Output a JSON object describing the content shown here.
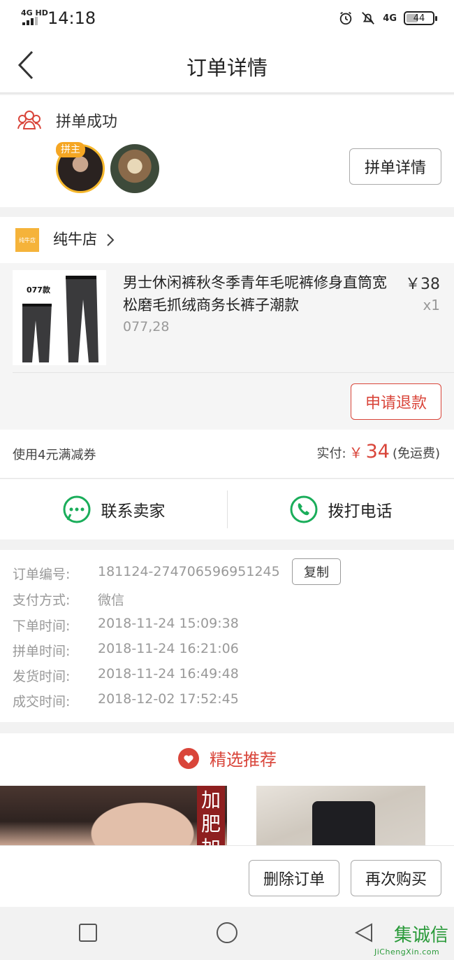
{
  "status_bar": {
    "network": "4G HD",
    "time": "14:18",
    "network_right": "4G",
    "battery": "44"
  },
  "header": {
    "title": "订单详情"
  },
  "group_buy": {
    "status": "拼单成功",
    "host_badge": "拼主",
    "detail_button": "拼单详情"
  },
  "shop": {
    "logo_text": "纯牛店",
    "name": "纯牛店"
  },
  "product": {
    "title": "男士休闲裤秋冬季青年毛呢裤修身直筒宽松磨毛抓绒商务长裤子潮款",
    "price": "￥38",
    "quantity": "x1",
    "sku": "077,28",
    "thumb_label": "077款",
    "refund_button": "申请退款"
  },
  "payment": {
    "coupon": "使用4元满减券",
    "paid_label": "实付:",
    "currency": "￥",
    "amount": "34",
    "shipping_note": "(免运费)"
  },
  "contact": {
    "seller": "联系卖家",
    "call": "拨打电话"
  },
  "order_info": [
    {
      "key": "订单编号:",
      "value": "181124-274706596951245"
    },
    {
      "key": "支付方式:",
      "value": "微信"
    },
    {
      "key": "下单时间:",
      "value": "2018-11-24 15:09:38"
    },
    {
      "key": "拼单时间:",
      "value": "2018-11-24 16:21:06"
    },
    {
      "key": "发货时间:",
      "value": "2018-11-24 16:49:48"
    },
    {
      "key": "成交时间:",
      "value": "2018-12-02 17:52:45"
    }
  ],
  "copy_button": "复制",
  "recommend": {
    "title": "精选推荐",
    "promo_tag": "加肥加"
  },
  "actions": {
    "delete": "删除订单",
    "rebuy": "再次购买"
  },
  "watermark": {
    "logo": "集诚信",
    "url": "JiChengXin.com"
  },
  "colors": {
    "accent": "#d9453a",
    "wechat_green": "#1aad5a",
    "badge_orange": "#f5a623"
  }
}
